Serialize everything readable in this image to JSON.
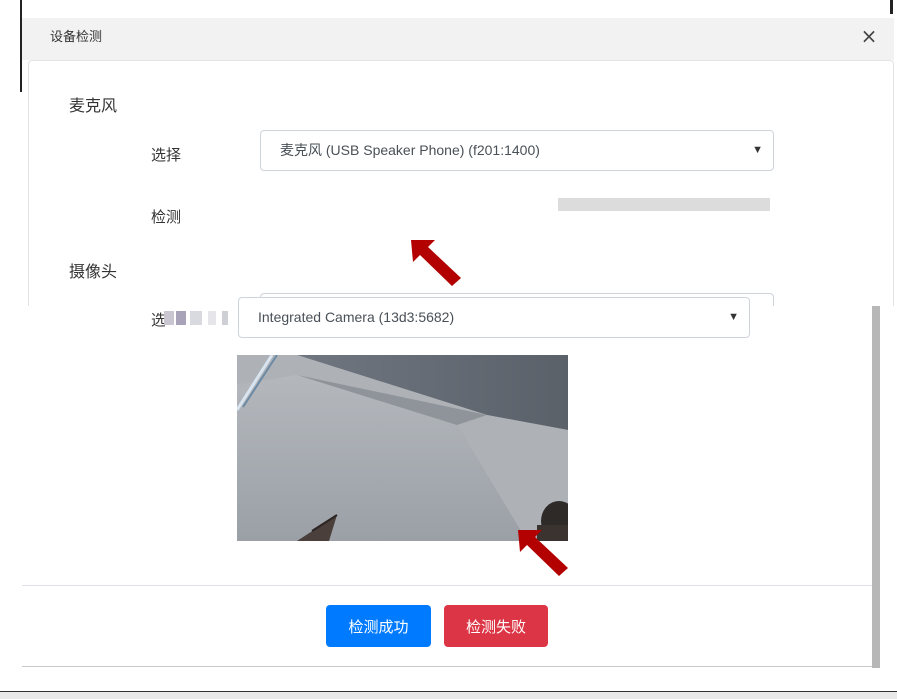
{
  "dialog": {
    "title": "设备检测",
    "close_label": "×"
  },
  "microphone": {
    "section_label": "麦克风",
    "select_label": "选择",
    "selected_device": "麦克风 (USB Speaker Phone) (f201:1400)",
    "test_label": "检测",
    "level": 0
  },
  "camera": {
    "section_label": "摄像头",
    "select_label": "选择",
    "selected_device": "Integrated Camera (13d3:5682)"
  },
  "footer": {
    "success_button": "检测成功",
    "fail_button": "检测失败"
  },
  "colors": {
    "primary": "#007bff",
    "danger": "#dc3545",
    "annotation_arrow": "#b30000"
  }
}
